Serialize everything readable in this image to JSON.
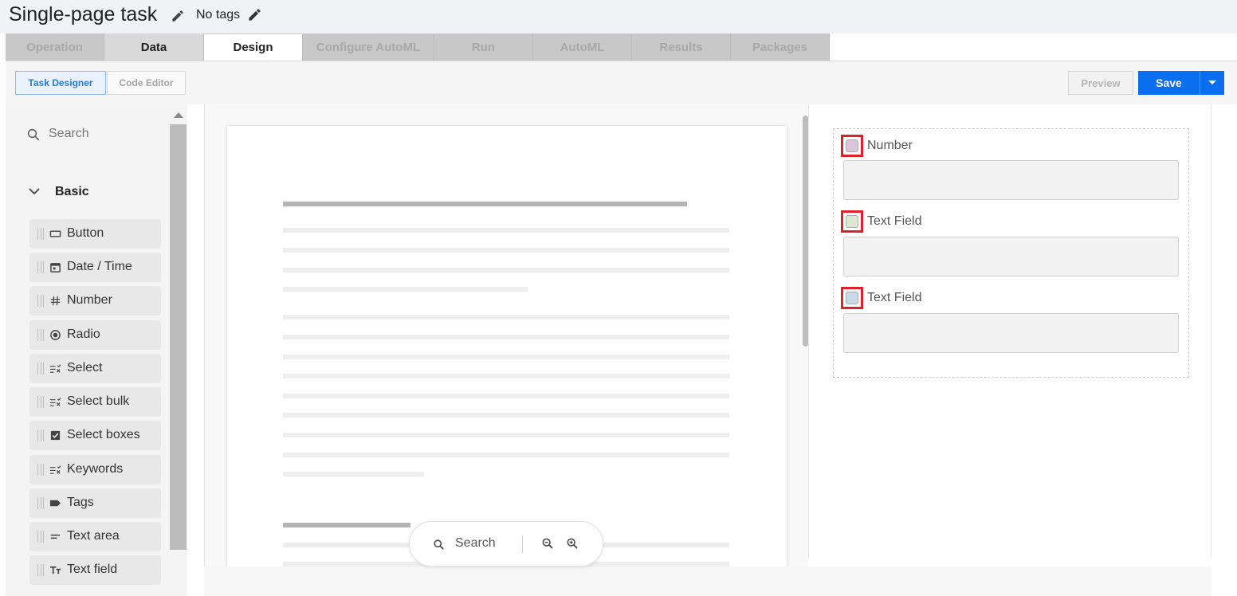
{
  "header": {
    "title": "Single-page task",
    "tags": "No tags"
  },
  "tabs": [
    {
      "label": "Operation"
    },
    {
      "label": "Data"
    },
    {
      "label": "Design"
    },
    {
      "label": "Configure AutoML"
    },
    {
      "label": "Run"
    },
    {
      "label": "AutoML"
    },
    {
      "label": "Results"
    },
    {
      "label": "Packages"
    }
  ],
  "toolbar": {
    "task_designer": "Task Designer",
    "code_editor": "Code Editor",
    "preview": "Preview",
    "save": "Save"
  },
  "sidebar": {
    "search_placeholder": "Search",
    "section": "Basic",
    "items": [
      {
        "label": "Button",
        "icon": "button-icon"
      },
      {
        "label": "Date / Time",
        "icon": "calendar-icon"
      },
      {
        "label": "Number",
        "icon": "hash-icon"
      },
      {
        "label": "Radio",
        "icon": "radio-icon"
      },
      {
        "label": "Select",
        "icon": "select-icon"
      },
      {
        "label": "Select bulk",
        "icon": "select-icon"
      },
      {
        "label": "Select boxes",
        "icon": "checkbox-icon"
      },
      {
        "label": "Keywords",
        "icon": "select-icon"
      },
      {
        "label": "Tags",
        "icon": "tag-icon"
      },
      {
        "label": "Text area",
        "icon": "text-area-icon"
      },
      {
        "label": "Text field",
        "icon": "text-field-icon"
      }
    ]
  },
  "canvas": {
    "search_label": "Search"
  },
  "fields": [
    {
      "label": "Number",
      "color": "#d9c6dc"
    },
    {
      "label": "Text Field",
      "color": "#dce8d2"
    },
    {
      "label": "Text Field",
      "color": "#c9d9ea"
    }
  ],
  "colors": {
    "accent": "#0a6ef0",
    "highlight": "#e0202a"
  }
}
